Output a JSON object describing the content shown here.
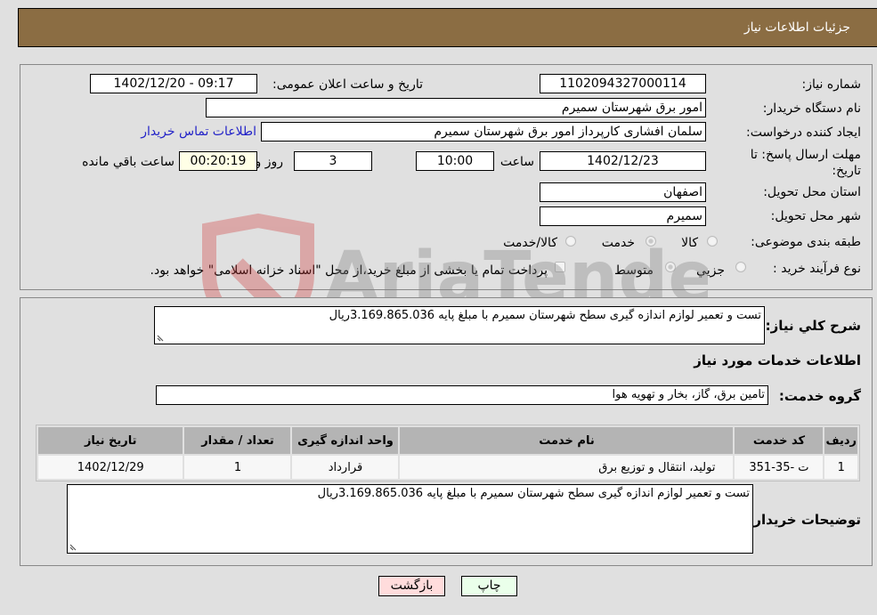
{
  "header": {
    "title": "جزئیات اطلاعات نیاز"
  },
  "details": {
    "need_number_label": "شماره نیاز:",
    "need_number": "1102094327000114",
    "announce_label": "تاریخ و ساعت اعلان عمومی:",
    "announce_value": "1402/12/20 - 09:17",
    "buyer_org_label": "نام دستگاه خریدار:",
    "buyer_org": "امور برق شهرستان سمیرم",
    "creator_label": "ایجاد کننده درخواست:",
    "creator": "سلمان  افشاری کارپرداز امور برق شهرستان سمیرم",
    "contact_link": "اطلاعات تماس خریدار",
    "deadline_label": "مهلت ارسال پاسخ: تا تاریخ:",
    "deadline_date": "1402/12/23",
    "time_label": "ساعت",
    "deadline_time": "10:00",
    "days_value": "3",
    "days_label": "روز و",
    "remaining_time": "00:20:19",
    "remaining_label": "ساعت باقي مانده",
    "province_label": "استان محل تحویل:",
    "province": "اصفهان",
    "city_label": "شهر محل تحویل:",
    "city": "سمیرم",
    "category_label": "طبقه بندی موضوعی:",
    "category_options": [
      "کالا",
      "خدمت",
      "کالا/خدمت"
    ],
    "category_selected": "خدمت",
    "process_label": "نوع فرآیند خرید :",
    "process_options": [
      "جزيي",
      "متوسط"
    ],
    "process_selected": "متوسط",
    "treasury_note": "پرداخت تمام یا بخشی از مبلغ خرید،از محل \"اسناد خزانه اسلامی\" خواهد بود."
  },
  "summary": {
    "label": "شرح کلي نياز:",
    "value": "تست و تعمیر لوازم اندازه گیری سطح شهرستان سمیرم با مبلغ پایه 3.169.865.036ریال"
  },
  "services": {
    "section_title": "اطلاعات خدمات مورد نیاز",
    "group_label": "گروه خدمت:",
    "group_value": "تامین برق، گاز، بخار و تهویه هوا",
    "table": {
      "headers": [
        "ردیف",
        "کد خدمت",
        "نام خدمت",
        "واحد اندازه گیری",
        "تعداد / مقدار",
        "تاریخ نیاز"
      ],
      "rows": [
        [
          "1",
          "ت -35-351",
          "تولید، انتقال و توزیع برق",
          "قرارداد",
          "1",
          "1402/12/29"
        ]
      ]
    }
  },
  "buyer_notes": {
    "label": "توضیحات خریدار:",
    "value": "تست و تعمیر لوازم اندازه گیری سطح شهرستان سمیرم با مبلغ پایه 3.169.865.036ریال"
  },
  "buttons": {
    "print": "چاپ",
    "back": "بازگشت"
  },
  "watermark": {
    "text": "AriaTender.neT"
  },
  "colors": {
    "header_bg": "#8b6d43",
    "print_bg": "#eaffea",
    "back_bg": "#ffdcdc",
    "link": "#2323c8"
  }
}
